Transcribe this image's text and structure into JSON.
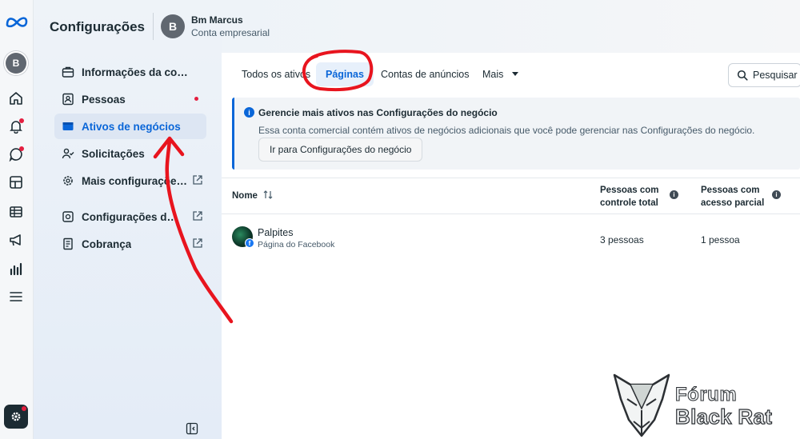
{
  "app": {
    "title": "Configurações"
  },
  "account": {
    "avatar_letter": "B",
    "name": "Bm Marcus",
    "type": "Conta empresarial"
  },
  "rail": {
    "avatar_letter": "B",
    "icons": [
      "meta-logo-icon",
      "home-icon",
      "bell-icon",
      "chat-icon",
      "pages-icon",
      "table-icon",
      "megaphone-icon",
      "bar-chart-icon",
      "menu-icon",
      "gear-icon"
    ]
  },
  "sidebar": {
    "items": [
      {
        "label": "Informações da conta",
        "icon": "briefcase-icon"
      },
      {
        "label": "Pessoas",
        "icon": "id-card-icon"
      },
      {
        "label": "Ativos de negócios",
        "icon": "assets-icon"
      },
      {
        "label": "Solicitações",
        "icon": "person-check-icon"
      },
      {
        "label": "Mais configurações do negócio",
        "icon": "gear-icon"
      },
      {
        "label": "Configurações da central de contas",
        "icon": "accounts-center-icon"
      },
      {
        "label": "Cobrança",
        "icon": "receipt-icon"
      }
    ]
  },
  "tabs": [
    {
      "label": "Todos os ativos"
    },
    {
      "label": "Páginas"
    },
    {
      "label": "Contas de anúncios"
    },
    {
      "label": "Mais"
    }
  ],
  "search": {
    "label": "Pesquisar"
  },
  "notice": {
    "title": "Gerencie mais ativos nas Configurações do negócio",
    "body": "Essa conta comercial contém ativos de negócios adicionais que você pode gerenciar nas Configurações do negócio.",
    "button": "Ir para Configurações do negócio"
  },
  "table": {
    "headers": {
      "name": "Nome",
      "full_control_line1": "Pessoas com",
      "full_control_line2": "controle total",
      "partial_line1": "Pessoas com",
      "partial_line2": "acesso parcial"
    },
    "rows": [
      {
        "name": "Palpites",
        "type": "Página do Facebook",
        "full_control": "3 pessoas",
        "partial": "1 pessoa"
      }
    ]
  },
  "watermark": {
    "line1": "Fórum",
    "line2": "Black Rat"
  },
  "colors": {
    "accent": "#0a66d8",
    "annotation": "#e8141e",
    "badge": "#e41e3f"
  }
}
